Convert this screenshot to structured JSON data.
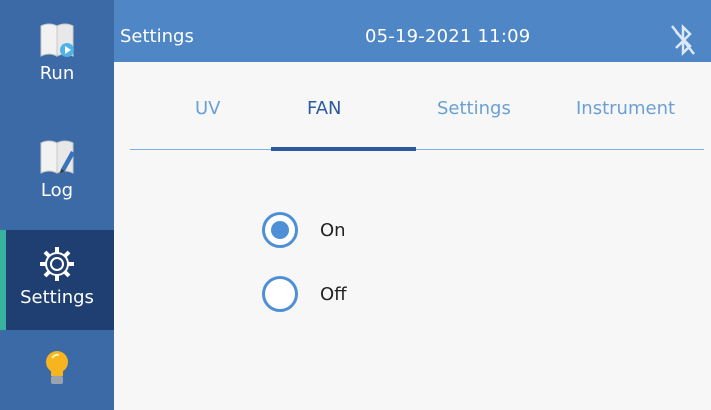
{
  "sidebar": {
    "items": [
      {
        "label": "Run",
        "icon": "run-doc-icon"
      },
      {
        "label": "Log",
        "icon": "log-doc-icon"
      },
      {
        "label": "Settings",
        "icon": "gear-icon",
        "selected": true
      },
      {
        "label": "",
        "icon": "lightbulb-icon"
      }
    ]
  },
  "header": {
    "title": "Settings",
    "datetime": "05-19-2021 11:09",
    "status_icon": "bluetooth-disabled-icon"
  },
  "tabs": {
    "items": [
      {
        "label": "UV"
      },
      {
        "label": "FAN"
      },
      {
        "label": "Settings"
      },
      {
        "label": "Instrument"
      }
    ],
    "active": "FAN"
  },
  "fan": {
    "options": [
      {
        "label": "On",
        "checked": true
      },
      {
        "label": "Off",
        "checked": false
      }
    ]
  },
  "colors": {
    "sidebar": "#3b6aa6",
    "sidebar_selected": "#1f3f73",
    "header": "#4e86c6",
    "accent": "#4f8fd6"
  }
}
